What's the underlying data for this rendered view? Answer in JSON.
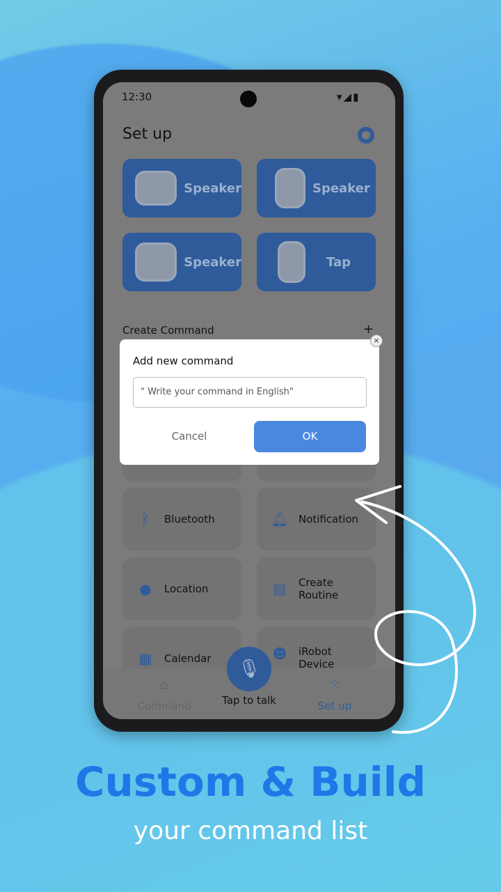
{
  "status": {
    "time": "12:30"
  },
  "header": {
    "title": "Set up"
  },
  "devices": [
    {
      "label": "Speaker"
    },
    {
      "label": "Speaker"
    },
    {
      "label": "Speaker"
    },
    {
      "label": "Tap"
    }
  ],
  "section": {
    "title": "Create Command",
    "add": "+"
  },
  "cards": [
    {
      "label": "Bluetooth",
      "icon": "bluetooth-icon"
    },
    {
      "label": "Notification",
      "icon": "bell-icon"
    },
    {
      "label": "Location",
      "icon": "location-pin-icon"
    },
    {
      "label": "Create Routine",
      "icon": "clipboard-icon"
    },
    {
      "label": "Calendar",
      "icon": "calendar-icon"
    },
    {
      "label": "iRobot Device",
      "icon": "robot-icon"
    }
  ],
  "nav": {
    "command": "Command",
    "talk": "Tap to talk",
    "setup": "Set up"
  },
  "dialog": {
    "title": "Add new command",
    "placeholder": "\" Write your command in English\"",
    "cancel": "Cancel",
    "ok": "OK",
    "close": "×"
  },
  "promo": {
    "headline": "Custom & Build",
    "subline": "your command list"
  },
  "colors": {
    "accent": "#4a88e0",
    "headline": "#1f78e8"
  }
}
